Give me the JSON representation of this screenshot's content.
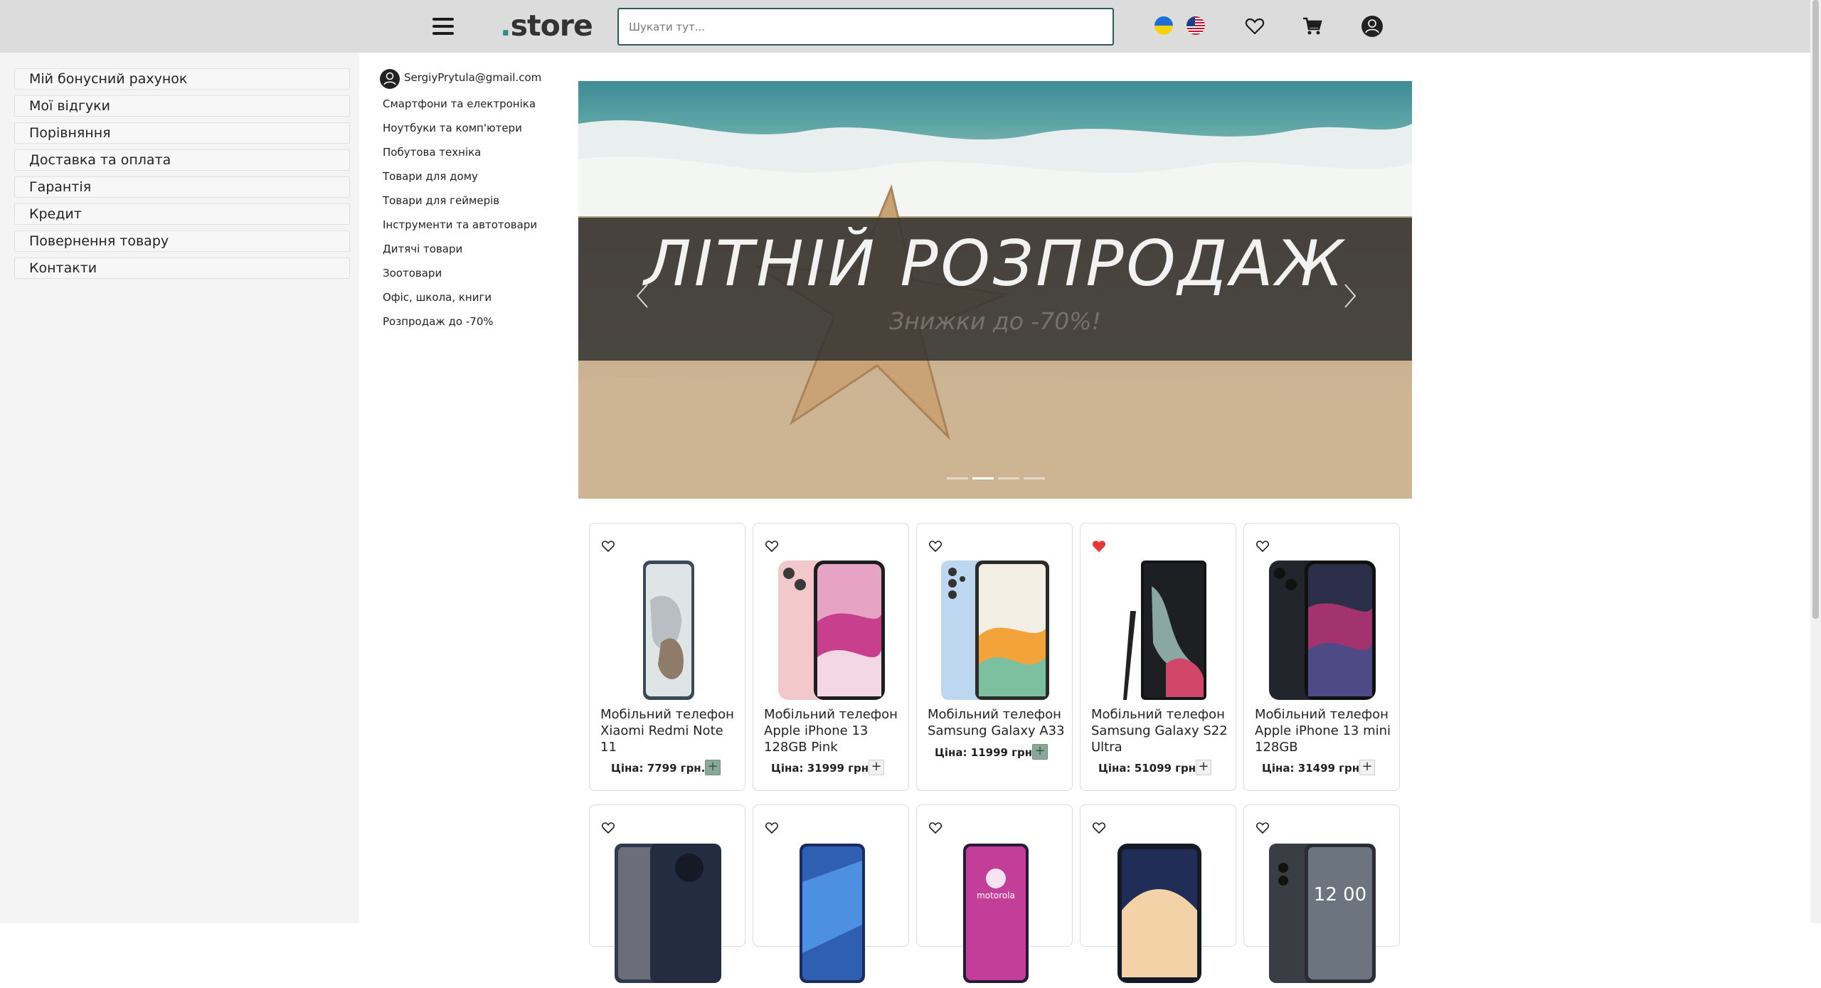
{
  "header": {
    "logo_mark": ".",
    "logo_text": "store",
    "search_placeholder": "Шукати тут...",
    "icons": [
      "menu-icon",
      "ukraine-flag-icon",
      "usa-flag-icon",
      "heart-icon",
      "cart-icon",
      "user-icon"
    ]
  },
  "sidebar": {
    "items": [
      {
        "label": "Мій бонусний рахунок"
      },
      {
        "label": "Мої відгуки"
      },
      {
        "label": "Порівняння"
      },
      {
        "label": "Доставка та оплата"
      },
      {
        "label": "Гарантія"
      },
      {
        "label": "Кредит"
      },
      {
        "label": "Повернення товару"
      },
      {
        "label": "Контакти"
      }
    ]
  },
  "account": {
    "email": "SergiyPrytula@gmail.com"
  },
  "categories": [
    "Смартфони та електроніка",
    "Ноутбуки та комп'ютери",
    "Побутова техніка",
    "Товари для дому",
    "Товари для геймерів",
    "Інструменти та автотовари",
    "Дитячі товари",
    "Зоотовари",
    "Офіс, школа, книги",
    "Розпродаж до -70%"
  ],
  "banner": {
    "title": "ЛІТНІЙ РОЗПРОДАЖ",
    "subtitle": "Знижки до -70%!",
    "slides": 4,
    "active_slide": 2
  },
  "products": [
    {
      "title": "Мобільний телефон Xiaomi Redmi Note 11",
      "price": "Ціна: 7799 грн.",
      "favorite": false,
      "add_highlight": true
    },
    {
      "title": "Мобільний телефон Apple iPhone 13 128GB Pink",
      "price": "Ціна: 31999 грн.",
      "favorite": false,
      "add_highlight": false
    },
    {
      "title": "Мобільний телефон Samsung Galaxy A33",
      "price": "Ціна: 11999 грн.",
      "favorite": false,
      "add_highlight": true
    },
    {
      "title": "Мобільний телефон Samsung Galaxy S22 Ultra",
      "price": "Ціна: 51099 грн.",
      "favorite": true,
      "add_highlight": false
    },
    {
      "title": "Мобільний телефон Apple iPhone 13 mini 128GB",
      "price": "Ціна: 31499 грн.",
      "favorite": false,
      "add_highlight": false
    }
  ],
  "second_row_products": [
    {
      "favorite": false,
      "screen_text": ""
    },
    {
      "favorite": false,
      "screen_text": ""
    },
    {
      "favorite": false,
      "screen_text": "motorola"
    },
    {
      "favorite": false,
      "screen_text": ""
    },
    {
      "favorite": false,
      "screen_text": "12 00"
    }
  ],
  "colors": {
    "header_bg": "#dcdcdc",
    "accent": "#2f8e83",
    "favorite_active": "#e53935"
  }
}
